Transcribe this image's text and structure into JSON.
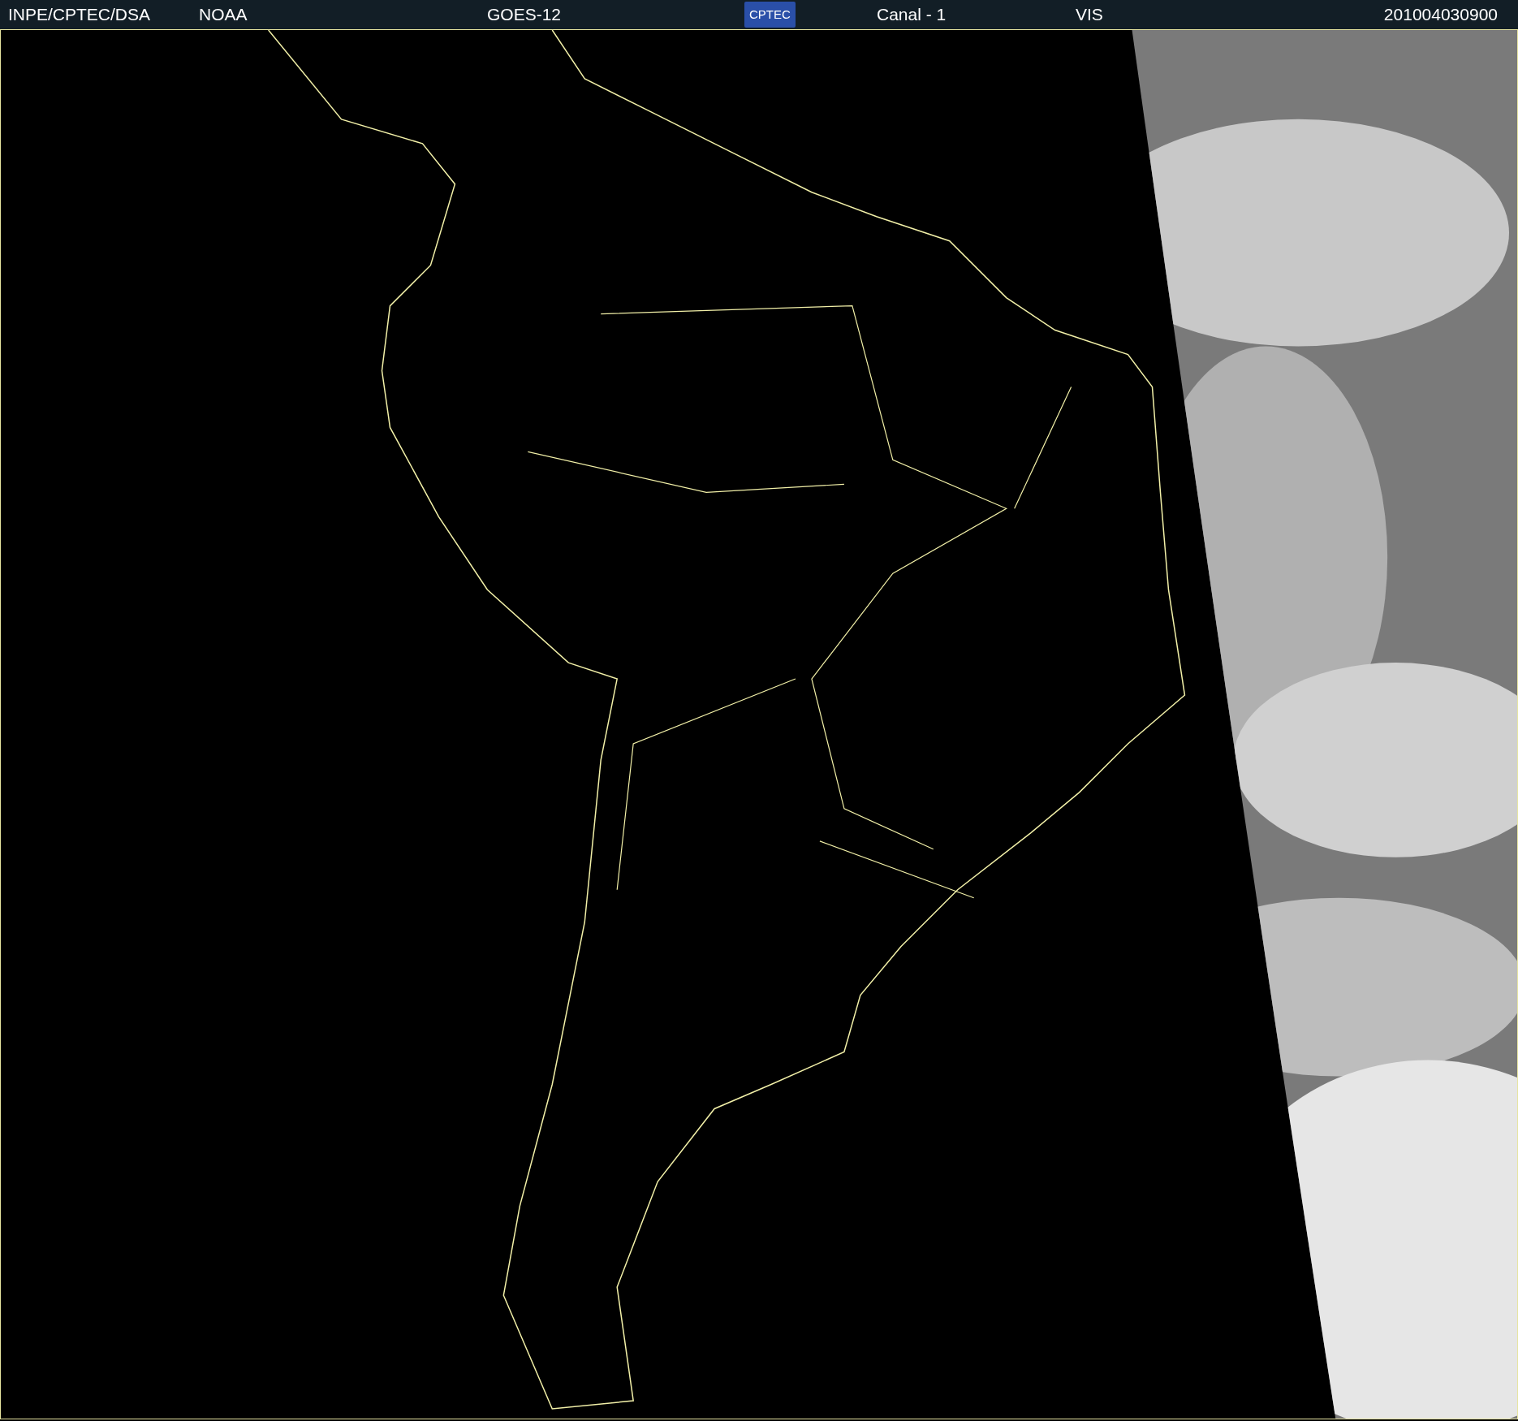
{
  "header": {
    "items": [
      {
        "kind": "text",
        "text": "INPE/CPTEC/DSA"
      },
      {
        "kind": "text",
        "text": "NOAA"
      },
      {
        "kind": "text",
        "text": "GOES-12"
      },
      {
        "kind": "logo",
        "text": "CPTEC"
      },
      {
        "kind": "text",
        "text": "Canal - 1"
      },
      {
        "kind": "text",
        "text": "VIS"
      },
      {
        "kind": "text",
        "text": "201004030900"
      }
    ]
  }
}
